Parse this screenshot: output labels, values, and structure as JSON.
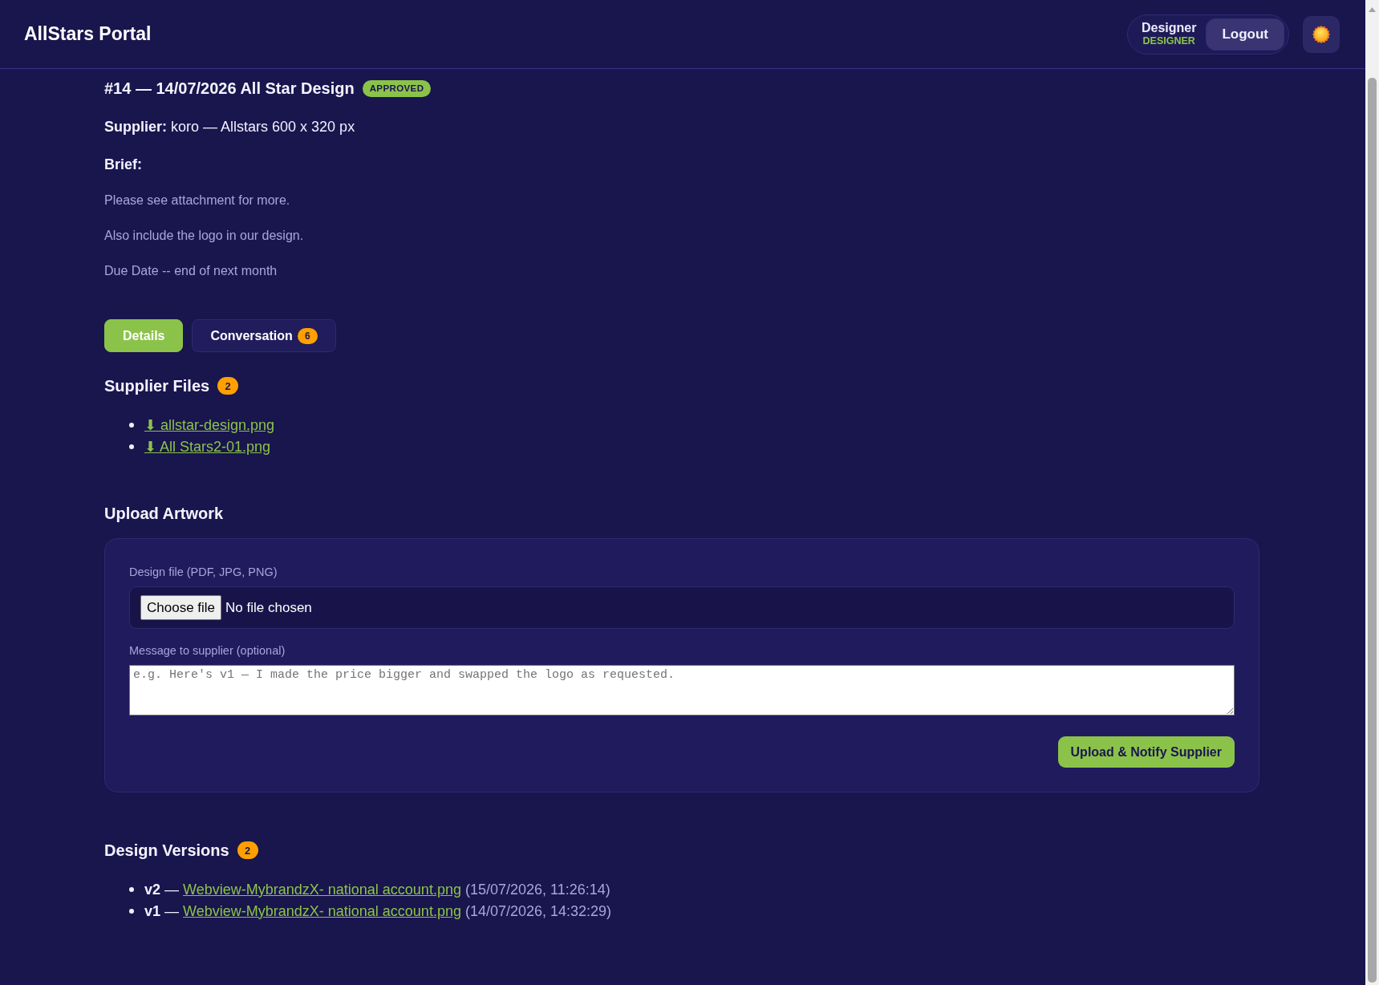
{
  "header": {
    "brand": "AllStars Portal",
    "user": {
      "name": "Designer",
      "role": "DESIGNER"
    },
    "logout": "Logout"
  },
  "job": {
    "title": "#14 — 14/07/2026 All Star Design",
    "status": "APPROVED",
    "supplier": "**Supplier:** koro — Allstars 600 x 320 px",
    "brief_label": "Brief:",
    "brief": [
      "Please see attachment for more.",
      "Also include the logo in our design.",
      "Due Date -- end of next month"
    ]
  },
  "tabs": [
    {
      "label": "Details",
      "selected": true
    },
    {
      "label": "Conversation",
      "selected": false,
      "count": "6"
    }
  ],
  "supplier_files": {
    "heading": "Supplier Files",
    "count": "2",
    "files": [
      "⬇ allstar-design.png",
      "⬇ All Stars2-01.png"
    ]
  },
  "upload": {
    "heading": "Upload Artwork",
    "file_label": "Design file (PDF, JPG, PNG)",
    "choose_button": "Choose file",
    "file_status": "No file chosen",
    "message_label": "Message to supplier (optional)",
    "message_placeholder": "e.g. Here's v1 — I made the price bigger and swapped the logo as requested.",
    "submit": "Upload & Notify Supplier"
  },
  "design_versions": {
    "heading": "Design Versions",
    "count": "2",
    "versions": [
      {
        "label": "**v2** —",
        "file": "Webview-MybrandzX- national account.png",
        "uploaded": "(15/07/2026, 11:26:14)"
      },
      {
        "label": "**v1** —",
        "file": "Webview-MybrandzX- national account.png",
        "uploaded": "(14/07/2026, 14:32:29)"
      }
    ]
  }
}
